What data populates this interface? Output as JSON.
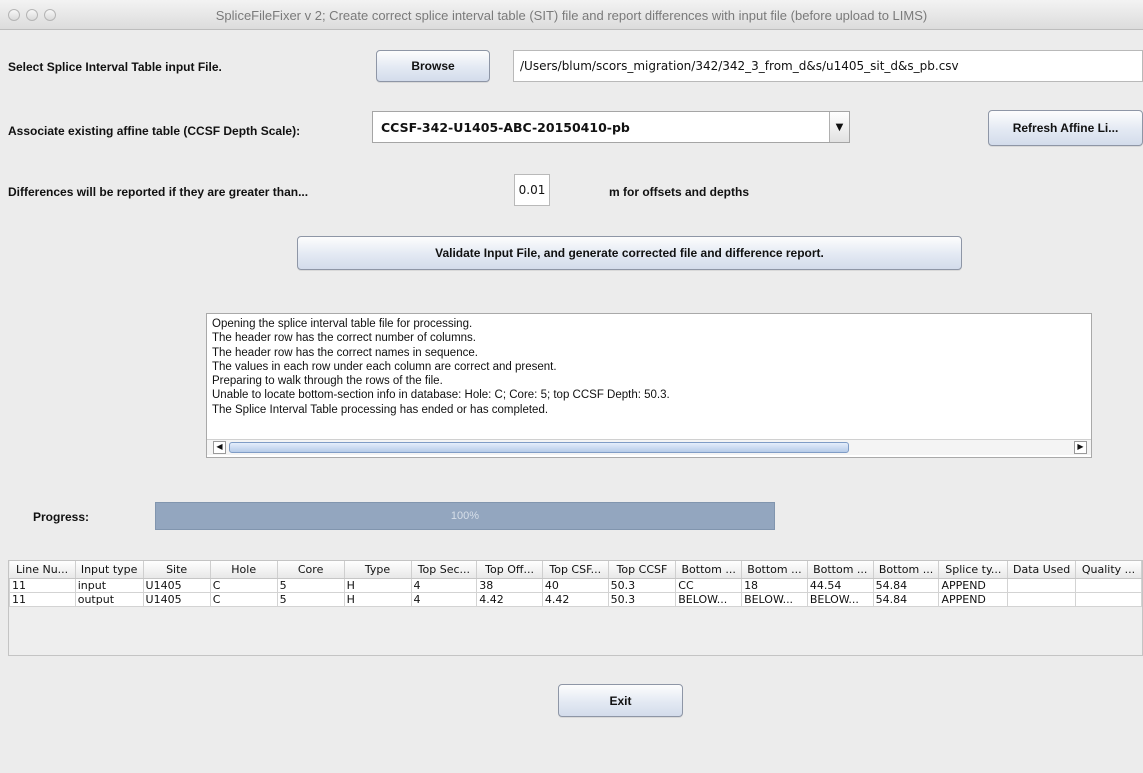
{
  "window": {
    "title": "SpliceFileFixer v 2; Create correct splice interval table (SIT) file and report differences with input file (before upload to LIMS)"
  },
  "input_file": {
    "label": "Select Splice Interval Table input File.",
    "browse_label": "Browse",
    "path": "/Users/blum/scors_migration/342/342_3_from_d&s/u1405_sit_d&s_pb.csv"
  },
  "affine": {
    "label": "Associate existing affine table (CCSF Depth Scale):",
    "selected": "CCSF-342-U1405-ABC-20150410-pb",
    "refresh_label": "Refresh Affine Li..."
  },
  "threshold": {
    "label": "Differences will be reported if they are greater than...",
    "value": "0.01",
    "unit": "m for offsets and depths"
  },
  "validate_label": "Validate Input File, and generate corrected file and difference report.",
  "log": [
    "Opening the splice interval table file for processing.",
    "The header row has the correct number of columns.",
    "The header row has the correct names in sequence.",
    "The values in each row under each column are correct and present.",
    "Preparing to walk through the rows of the file.",
    "Unable to locate bottom-section info in database: Hole: C;  Core: 5;  top CCSF Depth: 50.3.",
    "The Splice Interval Table processing has ended or has completed."
  ],
  "progress": {
    "label": "Progress:",
    "text": "100%",
    "value": 1.0
  },
  "table": {
    "columns": [
      "Line Nu...",
      "Input type",
      "Site",
      "Hole",
      "Core",
      "Type",
      "Top Sec...",
      "Top Off...",
      "Top CSF...",
      "Top CCSF",
      "Bottom ...",
      "Bottom ...",
      "Bottom ...",
      "Bottom ...",
      "Splice ty...",
      "Data Used",
      "Quality ..."
    ],
    "rows": [
      [
        "11",
        "input",
        "U1405",
        "C",
        "5",
        "H",
        "4",
        "38",
        "40",
        "50.3",
        "CC",
        "18",
        "44.54",
        "54.84",
        "APPEND",
        "",
        ""
      ],
      [
        "11",
        "output",
        "U1405",
        "C",
        "5",
        "H",
        "4",
        "4.42",
        "4.42",
        "50.3",
        "BELOW...",
        "BELOW...",
        "BELOW...",
        "54.84",
        "APPEND",
        "",
        ""
      ]
    ]
  },
  "exit_label": "Exit",
  "icons": {
    "combo_arrow": "chevron-down-icon",
    "scroll_left": "left-arrow-icon",
    "scroll_right": "right-arrow-icon"
  }
}
